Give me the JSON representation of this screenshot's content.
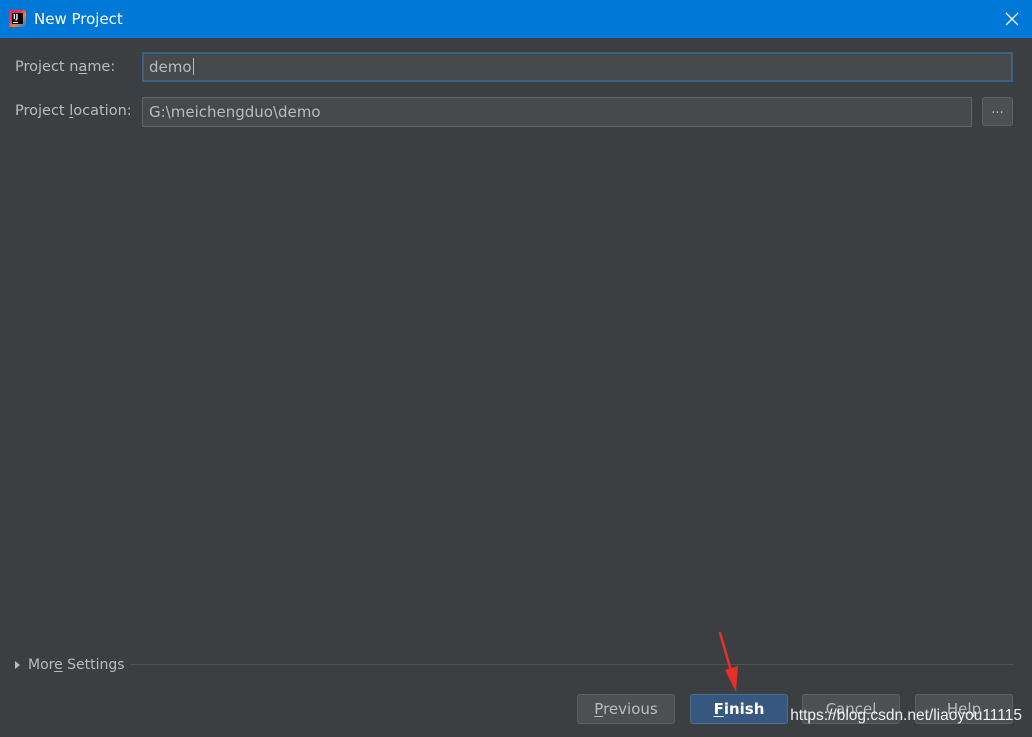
{
  "window": {
    "title": "New Project",
    "app_icon": "intellij-idea-icon",
    "app_icon_text": "IJ",
    "close_icon": "close-icon"
  },
  "form": {
    "name": {
      "label_pre": "Project n",
      "label_mnemonic": "a",
      "label_post": "me:",
      "value": "demo"
    },
    "location": {
      "label_pre": "Project ",
      "label_mnemonic": "l",
      "label_post": "ocation:",
      "value": "G:\\meichengduo\\demo",
      "browse_label": "..."
    }
  },
  "more_settings": {
    "pre": "Mor",
    "mnemonic": "e",
    "post": " Settings",
    "expand_icon": "triangle-right-icon"
  },
  "buttons": {
    "previous": {
      "mnemonic": "P",
      "rest": "revious"
    },
    "finish": {
      "mnemonic": "F",
      "rest": "inish"
    },
    "cancel": {
      "label": "Cancel"
    },
    "help": {
      "label": "Help"
    }
  },
  "annotation": {
    "arrow_icon": "red-arrow-icon",
    "arrow_color": "#e8302a"
  },
  "watermark": "https://blog.csdn.net/liaoyou11115",
  "colors": {
    "titlebar": "#0078d7",
    "background": "#3c3f41",
    "field_background": "#45494a",
    "focus_border": "#3d6185",
    "primary_button": "#365880",
    "text": "#bbbbbb"
  }
}
